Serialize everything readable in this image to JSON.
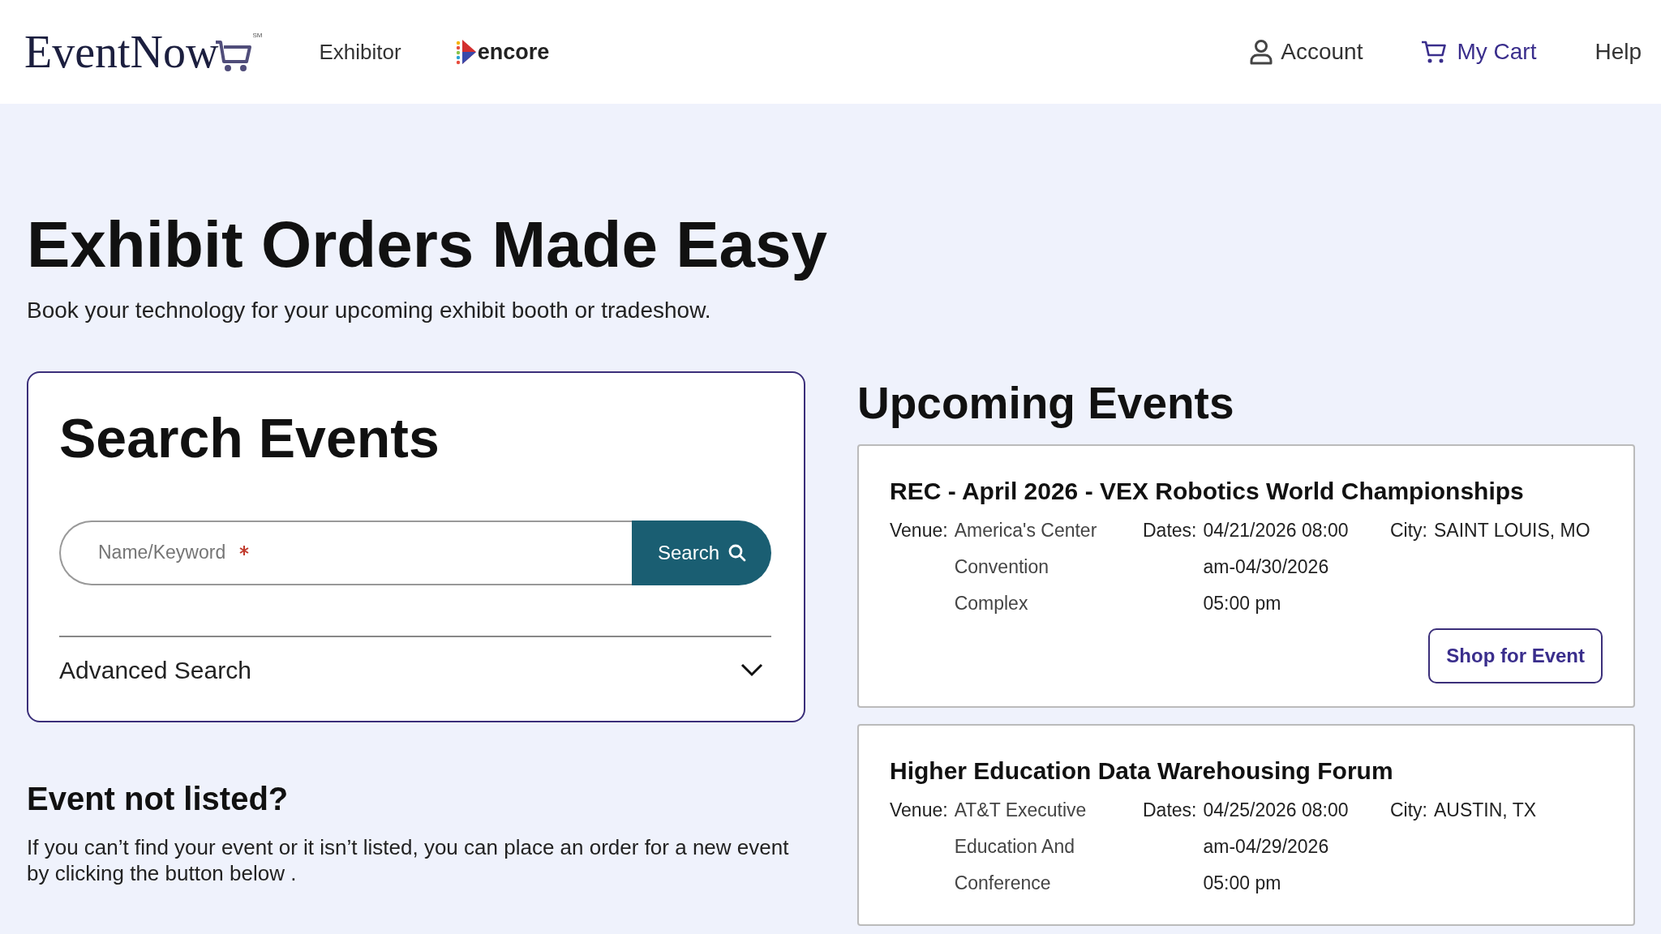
{
  "header": {
    "logo": {
      "text": "EventNow",
      "mark": "SM"
    },
    "nav_left": [
      {
        "label": "Exhibitor",
        "kind": "text"
      },
      {
        "label": "encore",
        "kind": "brand"
      }
    ],
    "nav_right": [
      {
        "label": "Account",
        "kind": "account"
      },
      {
        "label": "My Cart",
        "kind": "cart"
      },
      {
        "label": "Help",
        "kind": "text"
      }
    ]
  },
  "hero": {
    "title": "**Exhibit Orders** Made Easy",
    "subtitle": "Book your technology for your upcoming exhibit booth or tradeshow."
  },
  "search": {
    "title": "Search Events",
    "field": {
      "placeholder": "Name/Keyword",
      "required": true
    },
    "button": "Search",
    "advanced": {
      "label": "Advanced Search",
      "expanded": false
    }
  },
  "not_listed": {
    "title": "Event not listed?",
    "text": "If you can’t find your event or it isn’t listed, you can place an order for a new event by clicking the button below ."
  },
  "upcoming": {
    "title": "Upcoming Events",
    "events": [
      {
        "name": "REC - April 2026 - VEX Robotics World Championships",
        "venue_label": "Venue:",
        "venue": "America's Center Convention Complex",
        "dates_label": "Dates:",
        "dates": "04/21/2026 08:00 am-04/30/2026 05:00 pm",
        "city_label": "City:",
        "city": "SAINT LOUIS, MO",
        "button": "Shop for Event"
      },
      {
        "name": "Higher Education Data Warehousing Forum",
        "venue_label": "Venue:",
        "venue": "AT&T Executive Education And Conference",
        "dates_label": "Dates:",
        "dates": "04/25/2026 08:00 am-04/29/2026 05:00 pm",
        "city_label": "City:",
        "city": "AUSTIN, TX"
      }
    ]
  }
}
